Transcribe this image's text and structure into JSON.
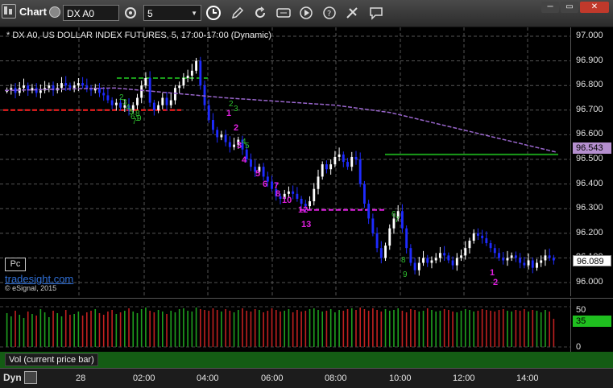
{
  "toolbar": {
    "app_title": "Chart",
    "symbol": "DX A0",
    "interval": "5",
    "icons": [
      "menu-icon",
      "cycle-icon",
      "time-icon",
      "pencil-icon",
      "refresh-icon",
      "settings-icon",
      "play-icon",
      "help-icon",
      "link-icon",
      "note-icon"
    ]
  },
  "chart": {
    "header": "* DX A0, US DOLLAR INDEX FUTURES, 5, 17:00-17:00 (Dynamic)",
    "badge": "Pc",
    "watermark": "tradesight.com",
    "copyright": "© eSignal, 2015",
    "price_tags": {
      "ma": "96.543",
      "last": "96.089"
    },
    "vol_panel_label": "Vol (current price bar)",
    "vol_value": "35",
    "bottom_label": "Dyn",
    "colors": {
      "up": "#ffffff",
      "down": "#1e2bff",
      "ma": "#9966cc",
      "green_line": "#1a9c1a",
      "red_line": "#ff2020",
      "magenta": "#e020e0"
    }
  },
  "chart_data": {
    "type": "candlestick",
    "title": "* DX A0, US DOLLAR INDEX FUTURES, 5, 17:00-17:00 (Dynamic)",
    "y_ticks": [
      "97.000",
      "96.900",
      "96.800",
      "96.700",
      "96.600",
      "96.500",
      "96.400",
      "96.300",
      "96.200",
      "96.100",
      "96.000"
    ],
    "ylim": [
      95.96,
      97.04
    ],
    "x_ticks": [
      "28",
      "02:00",
      "04:00",
      "06:00",
      "08:00",
      "10:00",
      "12:00",
      "14:00"
    ],
    "vol_ticks": [
      "50",
      "0"
    ],
    "closes": [
      96.78,
      96.79,
      96.77,
      96.79,
      96.8,
      96.78,
      96.79,
      96.77,
      96.78,
      96.79,
      96.8,
      96.78,
      96.79,
      96.81,
      96.8,
      96.79,
      96.8,
      96.81,
      96.8,
      96.79,
      96.78,
      96.79,
      96.77,
      96.76,
      96.74,
      96.72,
      96.73,
      96.71,
      96.72,
      96.7,
      96.72,
      96.75,
      96.8,
      96.83,
      96.73,
      96.7,
      96.72,
      96.75,
      96.72,
      96.74,
      96.79,
      96.8,
      96.83,
      96.84,
      96.86,
      96.9,
      96.8,
      96.72,
      96.66,
      96.62,
      96.59,
      96.6,
      96.57,
      96.55,
      96.56,
      96.58,
      96.54,
      96.5,
      96.47,
      96.45,
      96.47,
      96.43,
      96.41,
      96.38,
      96.35,
      96.34,
      96.36,
      96.37,
      96.36,
      96.34,
      96.32,
      96.31,
      96.33,
      96.38,
      96.43,
      96.48,
      96.46,
      96.48,
      96.51,
      96.52,
      96.49,
      96.47,
      96.51,
      96.5,
      96.4,
      96.32,
      96.26,
      96.2,
      96.14,
      96.1,
      96.15,
      96.22,
      96.26,
      96.29,
      96.22,
      96.14,
      96.08,
      96.05,
      96.08,
      96.1,
      96.08,
      96.09,
      96.1,
      96.12,
      96.11,
      96.09,
      96.07,
      96.1,
      96.11,
      96.14,
      96.17,
      96.2,
      96.19,
      96.18,
      96.16,
      96.14,
      96.12,
      96.1,
      96.09,
      96.1,
      96.11,
      96.1,
      96.08,
      96.07,
      96.09,
      96.06,
      96.08,
      96.09,
      96.11,
      96.1,
      96.09
    ],
    "ma_curve": [
      [
        0,
        96.78
      ],
      [
        0.2,
        96.79
      ],
      [
        0.4,
        96.75
      ],
      [
        0.6,
        96.72
      ],
      [
        0.7,
        96.69
      ],
      [
        1.0,
        96.53
      ]
    ],
    "vol_values": [
      42,
      38,
      45,
      40,
      36,
      44,
      41,
      39,
      47,
      43,
      37,
      45,
      42,
      38,
      46,
      40,
      41,
      44,
      39,
      43,
      45,
      47,
      42,
      40,
      44,
      46,
      41,
      43,
      45,
      48,
      44,
      42,
      47,
      49,
      45,
      43,
      46,
      44,
      41,
      45,
      43,
      47,
      48,
      45,
      44,
      49,
      47,
      46,
      45,
      48,
      46,
      44,
      47,
      45,
      43,
      46,
      48,
      45,
      44,
      47,
      46,
      43,
      45,
      48,
      46,
      44,
      45,
      47,
      43,
      46,
      44,
      45,
      47,
      48,
      46,
      44,
      45,
      47,
      43,
      46,
      45,
      47,
      48,
      46,
      49,
      47,
      45,
      48,
      46,
      44,
      47,
      45,
      46,
      48,
      45,
      43,
      47,
      46,
      44,
      45,
      48,
      46,
      44,
      45,
      47,
      46,
      44,
      43,
      45,
      47,
      46,
      44,
      45,
      47,
      46,
      45,
      44,
      46,
      47,
      45,
      44,
      46,
      45,
      47,
      44,
      46,
      45,
      43,
      46,
      44,
      35
    ],
    "annotations": {
      "td_sell_labels": [
        "1",
        "2",
        "3",
        "4",
        "5",
        "6",
        "7",
        "8",
        "10",
        "12",
        "13"
      ],
      "td_buy_labels": [
        "1",
        "2"
      ],
      "green_labels": [
        "2",
        "3",
        "4",
        "5",
        "6",
        "7",
        "8",
        "9",
        "1",
        "2",
        "3",
        "4",
        "5",
        "6",
        "7",
        "8",
        "9"
      ]
    }
  }
}
